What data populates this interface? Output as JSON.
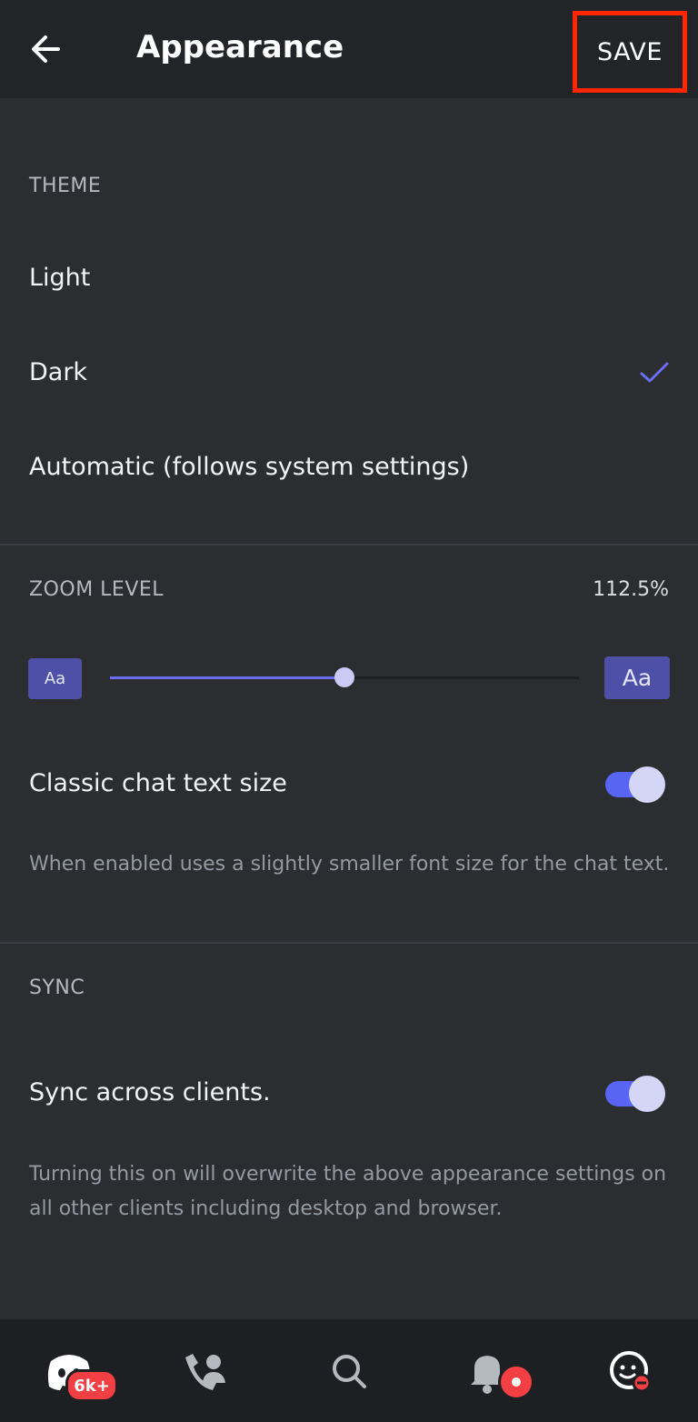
{
  "header": {
    "title": "Appearance",
    "save_label": "SAVE"
  },
  "theme": {
    "section_label": "THEME",
    "options": [
      {
        "label": "Light",
        "selected": false
      },
      {
        "label": "Dark",
        "selected": true
      },
      {
        "label": "Automatic (follows system settings)",
        "selected": false
      }
    ]
  },
  "zoom": {
    "section_label": "ZOOM LEVEL",
    "value_text": "112.5%",
    "slider_fraction": 0.5,
    "small_label": "Aa",
    "large_label": "Aa"
  },
  "classic_chat": {
    "label": "Classic chat text size",
    "enabled": true,
    "help": "When enabled uses a slightly smaller font size for the chat text."
  },
  "sync": {
    "section_label": "SYNC",
    "label": "Sync across clients.",
    "enabled": true,
    "help": "Turning this on will overwrite the above appearance settings on all other clients including desktop and browser."
  },
  "bottom_nav": {
    "items": [
      {
        "icon": "discord-home-icon"
      },
      {
        "icon": "friends-icon"
      },
      {
        "icon": "search-icon"
      },
      {
        "icon": "notifications-bell-icon"
      },
      {
        "icon": "profile-avatar-icon"
      }
    ],
    "home_badge": "6k+"
  },
  "colors": {
    "background": "#2b2d31",
    "header": "#232428",
    "accent": "#5865f2",
    "check": "#6b6ef2",
    "highlight_border": "#ff2600",
    "badge": "#f23f43"
  }
}
